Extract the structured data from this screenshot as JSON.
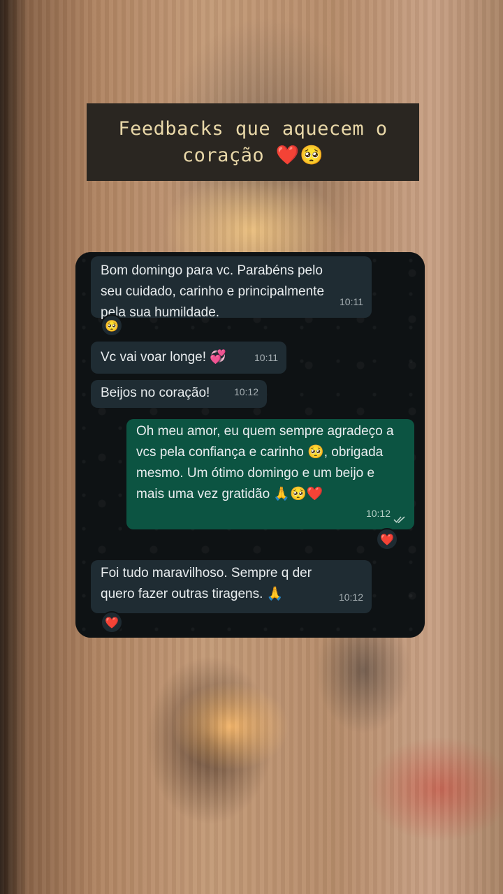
{
  "caption": {
    "text": "Feedbacks que aquecem o coração ❤️🥺"
  },
  "messages": [
    {
      "direction": "incoming",
      "text": "Bom domingo para vc. Parabéns pelo seu cuidado, carinho e principalmente pela sua humildade.",
      "time": "10:11",
      "reaction": "🥺"
    },
    {
      "direction": "incoming",
      "text": "Vc vai voar longe! 💞",
      "time": "10:11"
    },
    {
      "direction": "incoming",
      "text": "Beijos no coração!",
      "time": "10:12"
    },
    {
      "direction": "outgoing",
      "text": "Oh meu amor, eu quem sempre agradeço a vcs pela confiança e carinho 🥺, obrigada mesmo. Um ótimo domingo e um beijo e mais uma vez gratidão 🙏🥺❤️",
      "time": "10:12",
      "status_icon": "double-check-icon",
      "reaction": "❤️"
    },
    {
      "direction": "incoming",
      "text": "Foi tudo maravilhoso. Sempre q der quero fazer outras tiragens. 🙏",
      "time": "10:12",
      "reaction": "❤️"
    }
  ],
  "colors": {
    "incoming_bubble": "#1f2c33",
    "outgoing_bubble": "#0c5442",
    "caption_background": "#2a2621",
    "caption_text": "#e8d7a8",
    "reaction_heart": "#ef1f3a"
  }
}
